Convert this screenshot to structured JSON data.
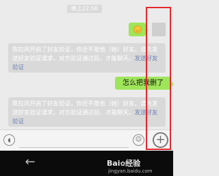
{
  "chat": {
    "timestamp": "晚上22:56",
    "notice_text": "陈拉风开启了好友验证，你还不是他（她）好友。请先发送好友验证请求，对方验证通过后，才能聊天。",
    "notice_link": "发送好友验证",
    "outgoing_text": "怎么把我删了",
    "emoji_icon": "smile-emoji"
  },
  "input_bar": {
    "voice_icon": "voice-icon",
    "emoji_icon": "emoji-icon",
    "plus_icon": "plus-icon",
    "plus_glyph": "+"
  },
  "nav": {
    "back_icon": "back-arrow-icon",
    "back_glyph": "←",
    "watermark_brand": "Bai",
    "watermark_brand_tail": "经验",
    "watermark_sub": "jingyan.baidu.com"
  },
  "colors": {
    "outgoing_bubble": "#9fe55a",
    "notice_bg": "#d9d9d9",
    "link": "#6e83b6",
    "highlight": "#e4282d"
  }
}
